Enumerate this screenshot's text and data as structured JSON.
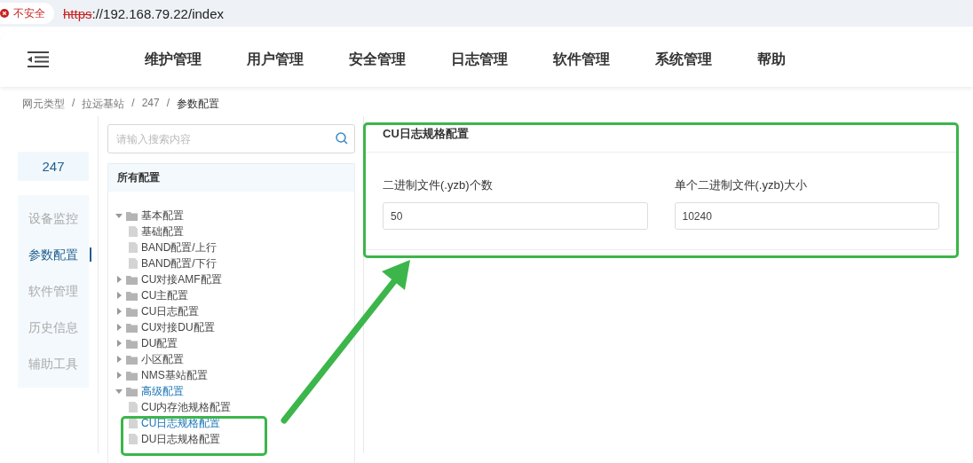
{
  "browser": {
    "security": "不安全",
    "scheme": "https",
    "address": "://192.168.79.22/index"
  },
  "nav": [
    "维护管理",
    "用户管理",
    "安全管理",
    "日志管理",
    "软件管理",
    "系统管理",
    "帮助"
  ],
  "breadcrumb": [
    {
      "kind": "link",
      "label": "网元类型"
    },
    {
      "kind": "separator",
      "label": "/"
    },
    {
      "kind": "link",
      "label": "拉远基站"
    },
    {
      "kind": "separator",
      "label": "/"
    },
    {
      "kind": "link",
      "label": "247"
    },
    {
      "kind": "separator",
      "label": "/"
    },
    {
      "kind": "current",
      "label": "参数配置"
    }
  ],
  "device": "247",
  "side_menu": [
    {
      "label": "设备监控",
      "selected": false
    },
    {
      "label": "参数配置",
      "selected": true
    },
    {
      "label": "软件管理",
      "selected": false
    },
    {
      "label": "历史信息",
      "selected": false
    },
    {
      "label": "辅助工具",
      "selected": false
    }
  ],
  "search": {
    "placeholder": "请输入搜索内容"
  },
  "tree": {
    "title": "所有配置",
    "nodes": [
      {
        "kind": "folder",
        "label": "基本配置",
        "expanded": true,
        "selected": false,
        "children": [
          {
            "kind": "file",
            "label": "基础配置",
            "selected": false
          },
          {
            "kind": "file",
            "label": "BAND配置/上行",
            "selected": false
          },
          {
            "kind": "file",
            "label": "BAND配置/下行",
            "selected": false
          }
        ]
      },
      {
        "kind": "folder",
        "label": "CU对接AMF配置",
        "expanded": false,
        "selected": false
      },
      {
        "kind": "folder",
        "label": "CU主配置",
        "expanded": false,
        "selected": false
      },
      {
        "kind": "folder",
        "label": "CU日志配置",
        "expanded": false,
        "selected": false
      },
      {
        "kind": "folder",
        "label": "CU对接DU配置",
        "expanded": false,
        "selected": false
      },
      {
        "kind": "folder",
        "label": "DU配置",
        "expanded": false,
        "selected": false
      },
      {
        "kind": "folder",
        "label": "小区配置",
        "expanded": false,
        "selected": false
      },
      {
        "kind": "folder",
        "label": "NMS基站配置",
        "expanded": false,
        "selected": false
      },
      {
        "kind": "folder",
        "label": "高级配置",
        "expanded": true,
        "selected": true,
        "children": [
          {
            "kind": "file",
            "label": "CU内存池规格配置",
            "selected": false
          },
          {
            "kind": "file",
            "label": "CU日志规格配置",
            "selected": true
          },
          {
            "kind": "file",
            "label": "DU日志规格配置",
            "selected": false
          }
        ]
      }
    ]
  },
  "panel": {
    "title": "CU日志规格配置",
    "fields": [
      {
        "label": "二进制文件(.yzb)个数",
        "value": "50"
      },
      {
        "label": "单个二进制文件(.yzb)大小",
        "value": "10240"
      }
    ]
  }
}
